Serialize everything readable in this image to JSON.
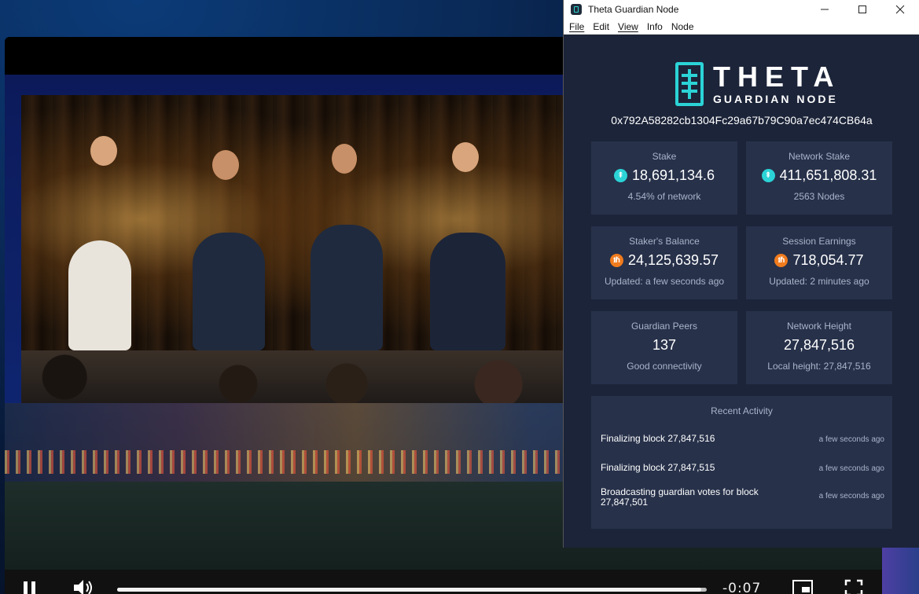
{
  "player": {
    "time_remaining": "-0:07",
    "progress": 0.99,
    "pause_icon": "pause-icon",
    "volume_icon": "volume-icon",
    "pip_icon": "picture-in-picture-icon",
    "fullscreen_icon": "fullscreen-icon"
  },
  "app": {
    "window_title": "Theta Guardian Node",
    "menu": [
      "File",
      "Edit",
      "View",
      "Info",
      "Node"
    ],
    "logo_title": "THETA",
    "logo_subtitle": "GUARDIAN NODE",
    "address": "0x792A58282cb1304Fc29a67b79C90a7ec474CB64a",
    "accent_color": "#2bd3d6",
    "tfuel_color": "#f07b1d",
    "cards": {
      "stake": {
        "label": "Stake",
        "value": "18,691,134.6",
        "sub": "4.54% of network",
        "icon": "theta-coin-icon"
      },
      "network_stake": {
        "label": "Network Stake",
        "value": "411,651,808.31",
        "sub": "2563 Nodes",
        "icon": "theta-coin-icon"
      },
      "stakers_balance": {
        "label": "Staker's Balance",
        "value": "24,125,639.57",
        "sub": "Updated: a few seconds ago",
        "icon": "tfuel-coin-icon"
      },
      "session_earnings": {
        "label": "Session Earnings",
        "value": "718,054.77",
        "sub": "Updated: 2 minutes ago",
        "icon": "tfuel-coin-icon"
      },
      "guardian_peers": {
        "label": "Guardian Peers",
        "value": "137",
        "sub": "Good connectivity"
      },
      "network_height": {
        "label": "Network Height",
        "value": "27,847,516",
        "sub": "Local height: 27,847,516"
      }
    },
    "activity": {
      "title": "Recent Activity",
      "items": [
        {
          "text": "Finalizing block 27,847,516",
          "time": "a few seconds ago"
        },
        {
          "text": "Finalizing block 27,847,515",
          "time": "a few seconds ago"
        },
        {
          "text": "Broadcasting guardian votes for block 27,847,501",
          "time": "a few seconds ago"
        }
      ]
    }
  }
}
